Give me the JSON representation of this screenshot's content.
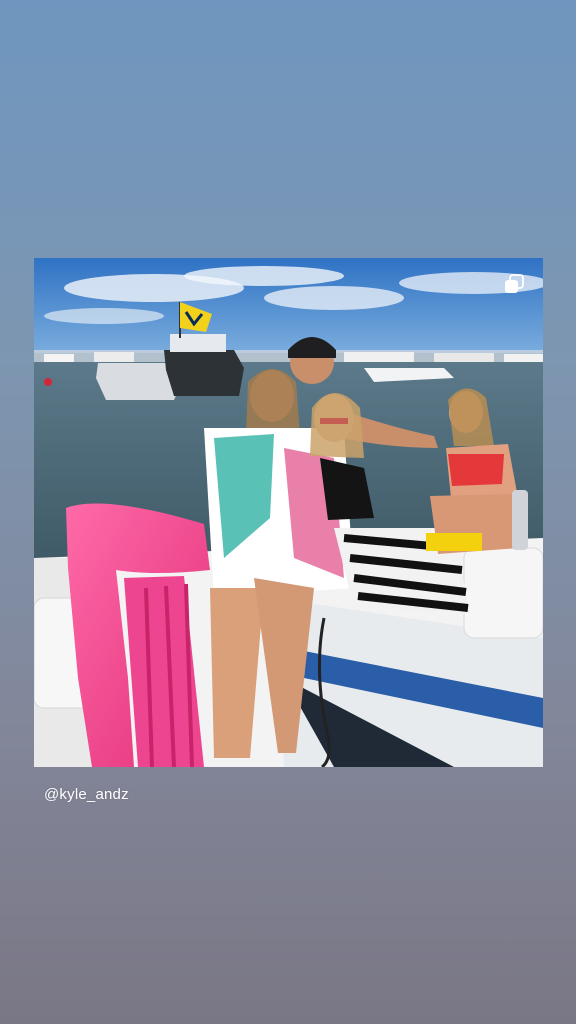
{
  "story": {
    "background_top": "#6f96bf",
    "background_bottom": "#7a7785"
  },
  "post": {
    "multi_photo_icon": "carousel-squares-icon",
    "flag_colors": {
      "yellow": "#f2d21b",
      "navy": "#0b2a5c"
    },
    "float_color": "#f0468f"
  },
  "mention": {
    "text": "@kyle_andz"
  }
}
